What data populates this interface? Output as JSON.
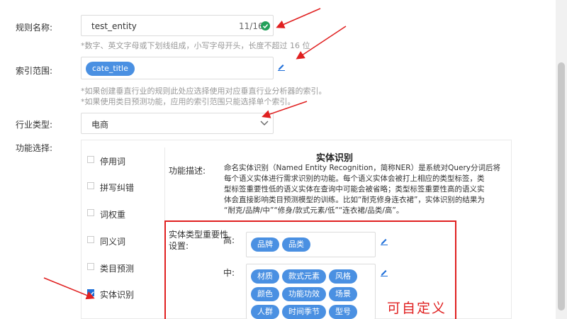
{
  "form": {
    "rule_name": {
      "label": "规则名称:",
      "value": "test_entity",
      "count": "11/16",
      "hint": "*数字、英文字母或下划线组成，小写字母开头，长度不超过 16 位"
    },
    "index_range": {
      "label": "索引范围:",
      "tags": [
        "cate_title"
      ],
      "hints": [
        "*如果创建垂直行业的规则此处应选择使用对应垂直行业分析器的索引。",
        "*如果使用类目预测功能，应用的索引范围只能选择单个索引。"
      ]
    },
    "industry": {
      "label": "行业类型:",
      "value": "电商"
    },
    "functions": {
      "label": "功能选择:",
      "items": [
        {
          "label": "停用词",
          "checked": false
        },
        {
          "label": "拼写纠错",
          "checked": false
        },
        {
          "label": "词权重",
          "checked": false
        },
        {
          "label": "同义词",
          "checked": false
        },
        {
          "label": "类目预测",
          "checked": false
        },
        {
          "label": "实体识别",
          "checked": true
        }
      ]
    }
  },
  "panel": {
    "title": "实体识别",
    "desc_label": "功能描述:",
    "desc_lines": [
      "命名实体识别（Named Entity Recognition，简称NER）是系统对Query分词后将",
      "每个语义实体进行需求识别的功能。每个语义实体会被打上相应的类型标签，类",
      "型标签重要性低的语义实体在查询中可能会被省略；类型标签重要性高的语义实",
      "体会直接影响类目预测模型的训练。比如“耐克修身连衣裙”，实体识别的结果为",
      "“耐克/品牌/中”“修身/款式元素/低”“连衣裙/品类/高”。"
    ],
    "importance_label_1": "实体类型重要性",
    "importance_label_2": "设置:",
    "high": {
      "label": "高:",
      "tags": [
        "品牌",
        "品类"
      ]
    },
    "mid": {
      "label": "中:",
      "tags": [
        "材质",
        "款式元素",
        "风格",
        "颜色",
        "功能功效",
        "场景",
        "人群",
        "时间季节",
        "型号"
      ]
    }
  },
  "annotation": {
    "text": "可自定义"
  },
  "colors": {
    "accent": "#4a90e2",
    "annotation": "#e02020",
    "success": "#22a05a"
  }
}
